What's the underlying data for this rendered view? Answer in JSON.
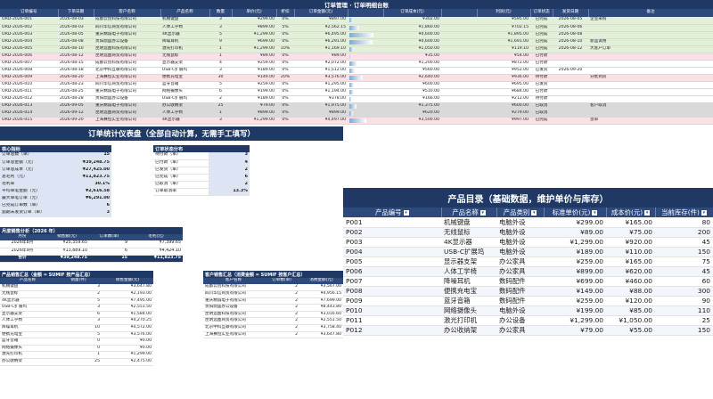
{
  "ledger": {
    "title": "订单管理 · 订单明细台账",
    "headers": [
      "订单编号",
      "下单日期",
      "客户名称",
      "产品名称",
      "数量",
      "单价(元)",
      "折扣",
      "订单金额(元)",
      "",
      "订单成本(元)",
      "",
      "利润(元)",
      "订单状态",
      "发货日期",
      "备注"
    ],
    "rows": [
      [
        "ORD-2026-001",
        "2026-08-03",
        "成都云创科技有限公司",
        "机械键盘",
        "3",
        "¥299.00",
        "0%",
        "¥897.00",
        "",
        "¥302.00",
        "",
        "¥595.00",
        "已完成",
        "2026-08-05",
        "企业采购"
      ],
      [
        "ORD-2026-002",
        "2026-08-03",
        "四川华信商贸有限公司",
        "人体工学椅",
        "3",
        "¥899.00",
        "5%",
        "¥2,562.15",
        "",
        "¥1,860.00",
        "",
        "¥702.15",
        "已完成",
        "2026-08-06",
        ""
      ],
      [
        "ORD-2026-003",
        "2026-08-05",
        "重庆精诚电子有限公司",
        "4K显示器",
        "5",
        "¥1,299.00",
        "0%",
        "¥6,495.00",
        "",
        "¥4,600.00",
        "",
        "¥1,895.00",
        "已完成",
        "2026-08-08",
        ""
      ],
      [
        "ORD-2026-004",
        "2026-08-08",
        "贵阳鼎盛办公设备",
        "降噪耳机",
        "9",
        "¥699.00",
        "0%",
        "¥6,291.00",
        "",
        "¥4,600.00",
        "",
        "¥1,691.00",
        "已完成",
        "2026-08-10",
        "新品试用"
      ],
      [
        "ORD-2026-005",
        "2026-08-10",
        "昆明远图科技有限公司",
        "激光打印机",
        "1",
        "¥1,299.00",
        "10%",
        "¥1,169.10",
        "",
        "¥1,050.00",
        "",
        "¥119.10",
        "已完成",
        "2026-08-12",
        "大客户订单"
      ],
      [
        "ORD-2026-006",
        "2026-08-12",
        "昆明远图商贸有限公司",
        "无线鼠标",
        "1",
        "¥89.00",
        "0%",
        "¥89.00",
        "",
        "¥35.00",
        "",
        "¥54.00",
        "已付款",
        "",
        ""
      ],
      [
        "ORD-2026-007",
        "2026-08-15",
        "成都云创科技有限公司",
        "显示器支架",
        "4",
        "¥259.00",
        "0%",
        "¥2,072.00",
        "",
        "¥1,200.00",
        "",
        "¥872.00",
        "已付款",
        "",
        ""
      ],
      [
        "ORD-2026-008",
        "2026-08-18",
        "北京中科互联有限公司",
        "USB-C扩展坞",
        "3",
        "¥189.00",
        "0%",
        "¥1,512.00",
        "",
        "¥560.00",
        "",
        "¥952.00",
        "已发货",
        "2026-09-20",
        ""
      ],
      [
        "ORD-2026-009",
        "2026-08-20",
        "上海赛恒实业有限公司",
        "便携充电宝",
        "30",
        "¥149.00",
        "20%",
        "¥3,576.00",
        "",
        "¥2,640.00",
        "",
        "¥936.00",
        "待付款",
        "",
        "分批到货"
      ],
      [
        "ORD-2026-010",
        "2026-08-23",
        "四川华信商贸有限公司",
        "蓝牙音箱",
        "5",
        "¥259.00",
        "0%",
        "¥1,295.00",
        "",
        "¥600.00",
        "",
        "¥695.00",
        "已发货",
        "",
        ""
      ],
      [
        "ORD-2026-011",
        "2026-08-25",
        "重庆精诚电子有限公司",
        "网络摄像头",
        "6",
        "¥199.00",
        "0%",
        "¥1,194.00",
        "",
        "¥510.00",
        "",
        "¥684.00",
        "已付款",
        "",
        ""
      ],
      [
        "ORD-2026-012",
        "2026-08-28",
        "贵阳鼎盛办公设备",
        "USB-C扩展坞",
        "2",
        "¥189.00",
        "0%",
        "¥378.00",
        "",
        "¥166.00",
        "",
        "¥212.00",
        "待付款",
        "",
        ""
      ],
      [
        "ORD-2026-013",
        "2026-09-05",
        "重庆精诚电子有限公司",
        "办公收纳架",
        "25",
        "¥79.00",
        "0%",
        "¥1,975.00",
        "",
        "¥1,375.00",
        "",
        "¥600.00",
        "已取消",
        "",
        "客户取消"
      ],
      [
        "ORD-2026-014",
        "2026-09-12",
        "昆明远图商贸有限公司",
        "人体工学椅",
        "1",
        "¥899.00",
        "0%",
        "¥899.00",
        "",
        "¥620.00",
        "",
        "¥279.00",
        "已取消",
        "",
        ""
      ],
      [
        "ORD-2026-015",
        "2026-09-20",
        "上海赛恒实业有限公司",
        "4K显示器",
        "3",
        "¥1,299.00",
        "0%",
        "¥4,497.00",
        "",
        "¥3,500.00",
        "",
        "¥997.00",
        "已完成",
        "",
        "急单"
      ]
    ],
    "bar_fractions": [
      0.1,
      0.3,
      0.75,
      0.72,
      0.14,
      0.02,
      0.24,
      0.17,
      0.41,
      0.15,
      0.14,
      0.05,
      0.23,
      0.1,
      0.52
    ]
  },
  "dashboard": {
    "title": "订单统计仪表盘（全部自动计算，无需手工填写）",
    "kpi_title": "核心指标",
    "kpis": [
      [
        "订单总数（单）",
        "15"
      ],
      [
        "订单总金额（元）",
        "¥39,248.75"
      ],
      [
        "订单总成本（元）",
        "¥27,425.00"
      ],
      [
        "总毛利（元）",
        "¥11,823.75"
      ],
      [
        "毛利率",
        "30.1%"
      ],
      [
        "平均单笔金额（元）",
        "¥2,616.58"
      ],
      [
        "最大单笔订单（元）",
        "¥6,291.00"
      ],
      [
        "已完成订单数（单）",
        "6"
      ],
      [
        "逾期未发货订单（单）",
        "3"
      ]
    ],
    "status_title": "订单状态分布",
    "status": [
      [
        "待付款（单）",
        "3"
      ],
      [
        "已付款（单）",
        "4"
      ],
      [
        "已发货（单）",
        "2"
      ],
      [
        "已完成（单）",
        "6"
      ],
      [
        "已取消（单）",
        "2"
      ],
      [
        "订单取消率",
        "13.3%"
      ]
    ],
    "monthly_title": "月度销售分析（2026 年）",
    "monthly_headers": [
      "月份",
      "销售额(元)",
      "订单数(单)",
      "毛利(元)"
    ],
    "monthly_rows": [
      [
        "2026年8月",
        "¥25,359.65",
        "9",
        "¥7,399.65"
      ],
      [
        "2026年9月",
        "¥13,889.10",
        "6",
        "¥4,424.10"
      ],
      [
        "合计",
        "¥39,248.75",
        "15",
        "¥11,823.75"
      ]
    ],
    "prod_title": "产品销售汇总（金额 = SUMIF 按产品汇总）",
    "prod_headers": [
      "产品名称",
      "销量(件)",
      "销售金额(元)"
    ],
    "prod_rows": [
      [
        "机械键盘",
        "3",
        "¥3,647.80"
      ],
      [
        "无线鼠标",
        "2",
        "¥2,193.00"
      ],
      [
        "4K显示器",
        "5",
        "¥7,495.00"
      ],
      [
        "USB-C扩展坞",
        "3",
        "¥2,551.50"
      ],
      [
        "显示器支架",
        "6",
        "¥1,584.00"
      ],
      [
        "人体工学椅",
        "3",
        "¥4,270.25"
      ],
      [
        "降噪耳机",
        "10",
        "¥4,572.00"
      ],
      [
        "便携充电宝",
        "5",
        "¥3,576.00"
      ],
      [
        "蓝牙音箱",
        "0",
        "¥0.00"
      ],
      [
        "网络摄像头",
        "0",
        "¥0.00"
      ],
      [
        "激光打印机",
        "1",
        "¥1,299.00"
      ],
      [
        "办公收纳架",
        "25",
        "¥2,475.00"
      ]
    ],
    "cust_title": "客户销售汇总（消费金额 = SUMIF 按客户汇总）",
    "cust_headers": [
      "客户名称",
      "订单数(单)",
      "消费金额(元)"
    ],
    "cust_rows": [
      [
        "成都云创科技有限公司",
        "2",
        "¥3,567.00"
      ],
      [
        "四川华信商贸有限公司",
        "2",
        "¥4,956.15"
      ],
      [
        "重庆精诚电子有限公司",
        "2",
        "¥7,699.00"
      ],
      [
        "贵阳鼎盛办公设备",
        "2",
        "¥8,443.80"
      ],
      [
        "昆明远图科技有限公司",
        "2",
        "¥3,016.60"
      ],
      [
        "昆明远图商贸有限公司",
        "2",
        "¥2,551.50"
      ],
      [
        "北京中科互联有限公司",
        "2",
        "¥3,758.40"
      ],
      [
        "上海赛恒实业有限公司",
        "2",
        "¥3,647.80"
      ]
    ]
  },
  "catalog": {
    "title": "产品目录（基础数据，维护单价与库存）",
    "headers": [
      "产品编号",
      "产品名称",
      "产品类别",
      "标准单价(元)",
      "成本价(元)",
      "当前库存(件)"
    ],
    "rows": [
      [
        "P001",
        "机械键盘",
        "电脑外设",
        "¥299.00",
        "¥165.00",
        "80"
      ],
      [
        "P002",
        "无线鼠标",
        "电脑外设",
        "¥89.00",
        "¥75.00",
        "200"
      ],
      [
        "P003",
        "4K显示器",
        "电脑外设",
        "¥1,299.00",
        "¥920.00",
        "45"
      ],
      [
        "P004",
        "USB-C扩展坞",
        "电脑外设",
        "¥189.00",
        "¥110.00",
        "150"
      ],
      [
        "P005",
        "显示器支架",
        "办公家具",
        "¥259.00",
        "¥165.00",
        "75"
      ],
      [
        "P006",
        "人体工学椅",
        "办公家具",
        "¥899.00",
        "¥620.00",
        "45"
      ],
      [
        "P007",
        "降噪耳机",
        "数码配件",
        "¥699.00",
        "¥460.00",
        "60"
      ],
      [
        "P008",
        "便携充电宝",
        "数码配件",
        "¥149.00",
        "¥88.00",
        "300"
      ],
      [
        "P009",
        "蓝牙音箱",
        "数码配件",
        "¥259.00",
        "¥120.00",
        "90"
      ],
      [
        "P010",
        "网络摄像头",
        "电脑外设",
        "¥199.00",
        "¥85.00",
        "110"
      ],
      [
        "P011",
        "激光打印机",
        "办公设备",
        "¥1,299.00",
        "¥1,050.00",
        "25"
      ],
      [
        "P012",
        "办公收纳架",
        "办公家具",
        "¥79.00",
        "¥55.00",
        "150"
      ]
    ]
  }
}
